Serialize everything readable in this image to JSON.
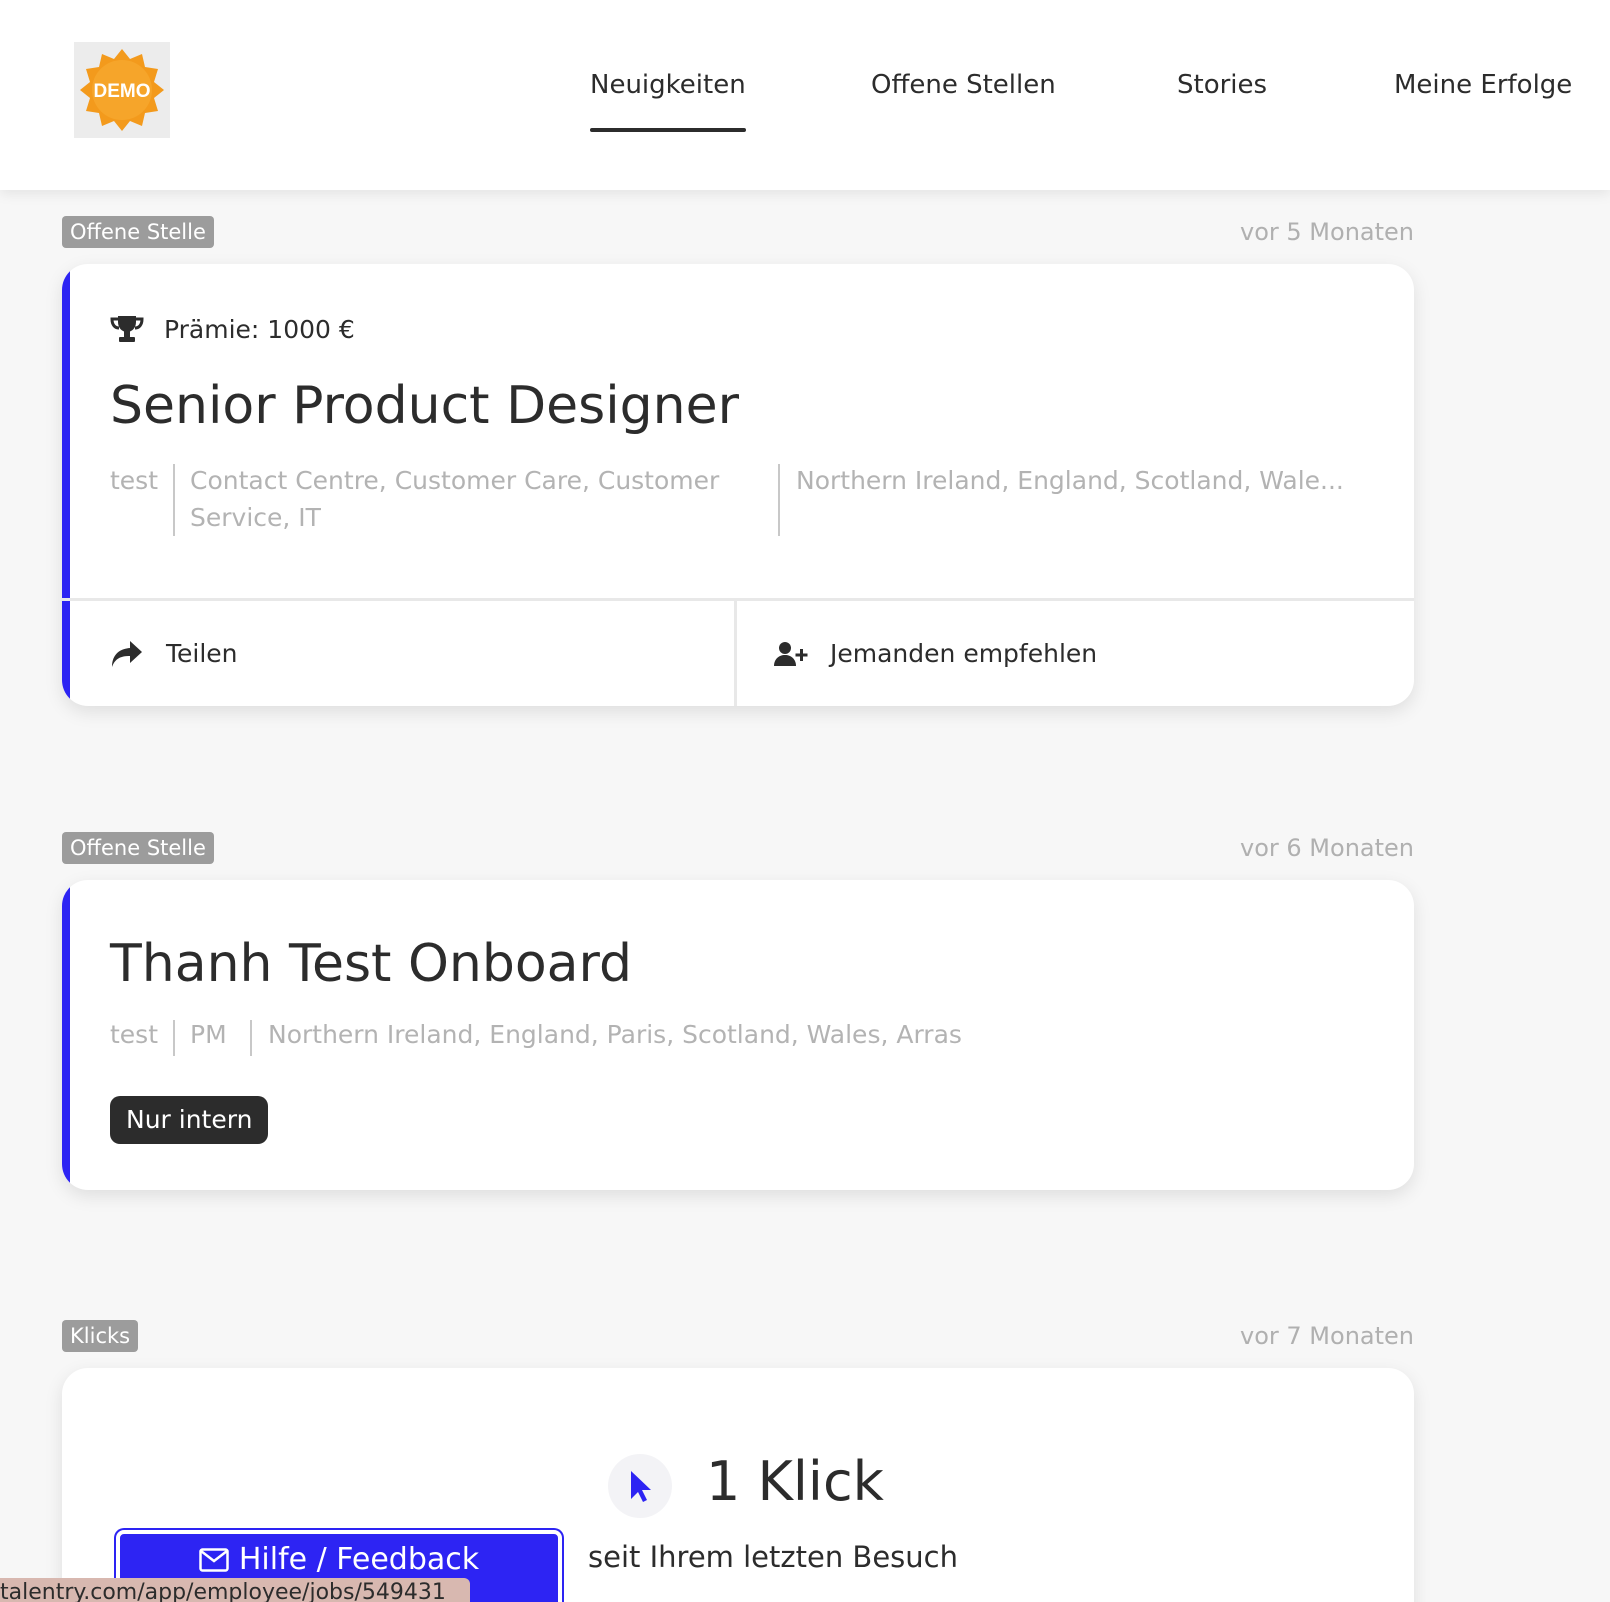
{
  "header": {
    "logo_text": "DEMO",
    "nav": [
      {
        "label": "Neuigkeiten",
        "active": true
      },
      {
        "label": "Offene Stellen",
        "active": false
      },
      {
        "label": "Stories",
        "active": false
      },
      {
        "label": "Meine Erfolge",
        "active": false
      }
    ]
  },
  "feed": [
    {
      "tag": "Offene Stelle",
      "time": "vor 5 Monaten",
      "bonus": "Prämie: 1000 €",
      "title": "Senior Product Designer",
      "company": "test",
      "categories": "Contact Centre, Customer Care, Customer Service, IT",
      "locations": "Northern Ireland, England, Scotland, Wale...",
      "share_label": "Teilen",
      "recommend_label": "Jemanden empfehlen"
    },
    {
      "tag": "Offene Stelle",
      "time": "vor 6 Monaten",
      "title": "Thanh Test Onboard",
      "company": "test",
      "categories": "PM",
      "locations": "Northern Ireland, England, Paris, Scotland, Wales, Arras",
      "badge": "Nur intern"
    },
    {
      "tag": "Klicks",
      "time": "vor 7 Monaten",
      "value": "1 Klick",
      "subtitle": "seit Ihrem letzten Besuch"
    }
  ],
  "feedback_button": "Hilfe / Feedback",
  "status_url": "talentry.com/app/employee/jobs/549431",
  "colors": {
    "accent": "#2d24f3",
    "logo_orange": "#f39a1c",
    "dark_pill": "#2c2c2c",
    "tag_gray": "#9c9c9c"
  },
  "icons": {
    "bonus": "trophy-icon",
    "share": "share-arrow-icon",
    "recommend": "user-plus-icon",
    "clicks": "cursor-icon",
    "feedback": "envelope-icon"
  }
}
